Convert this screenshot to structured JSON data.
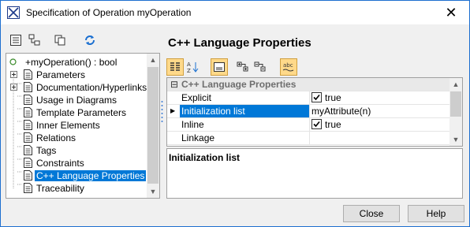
{
  "window": {
    "title": "Specification of Operation myOperation"
  },
  "left_toolbar": {
    "icons": [
      "list-view-icon",
      "tree-view-icon",
      "copy-icon",
      "refresh-icon"
    ]
  },
  "tree": {
    "root": "+myOperation() : bool",
    "items": [
      {
        "label": "Parameters",
        "expandable": true
      },
      {
        "label": "Documentation/Hyperlinks",
        "expandable": true
      },
      {
        "label": "Usage in Diagrams",
        "expandable": false
      },
      {
        "label": "Template Parameters",
        "expandable": false
      },
      {
        "label": "Inner Elements",
        "expandable": false
      },
      {
        "label": "Relations",
        "expandable": false
      },
      {
        "label": "Tags",
        "expandable": false
      },
      {
        "label": "Constraints",
        "expandable": false
      },
      {
        "label": "C++ Language Properties",
        "expandable": false,
        "selected": true
      },
      {
        "label": "Traceability",
        "expandable": false
      }
    ]
  },
  "right": {
    "title": "C++ Language Properties",
    "toolbar_icons": [
      "categorized-icon",
      "sort-alpha-icon",
      "description-icon",
      "expand-all-icon",
      "collapse-all-icon",
      "abc-icon"
    ],
    "group": "C++ Language Properties",
    "properties": [
      {
        "name": "Explicit",
        "value": "true",
        "checkbox": true,
        "checked": true,
        "selected": false
      },
      {
        "name": "Initialization list",
        "value": "myAttribute(n)",
        "checkbox": false,
        "selected": true
      },
      {
        "name": "Inline",
        "value": "true",
        "checkbox": true,
        "checked": true,
        "selected": false
      },
      {
        "name": "Linkage",
        "value": "",
        "checkbox": false,
        "selected": false
      }
    ],
    "description_title": "Initialization list"
  },
  "buttons": {
    "close": "Close",
    "help": "Help"
  },
  "colors": {
    "selection": "#0078d7",
    "toggle_on": "#ffd98a",
    "window_border": "#1e6fd0"
  }
}
